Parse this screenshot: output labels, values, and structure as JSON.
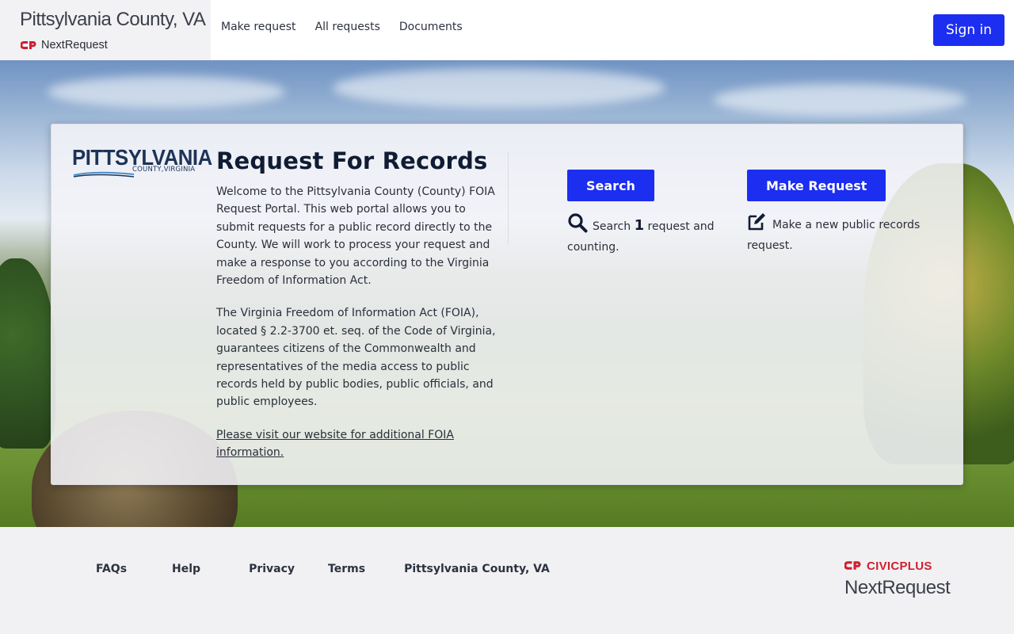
{
  "header": {
    "org_title": "Pittsylvania County, VA",
    "product_name": "NextRequest",
    "nav": [
      {
        "label": "Make request"
      },
      {
        "label": "All requests"
      },
      {
        "label": "Documents"
      }
    ],
    "signin_label": "Sign in"
  },
  "card": {
    "logo_word": "PITTSYLVANIA",
    "logo_tag": "COUNTY,VIRGINIA",
    "title": "Request For Records",
    "paragraph_1": "Welcome to the Pittsylvania County (County) FOIA Request Portal. This web portal allows you to submit requests for a public record directly to the County. We will work to process your request and make a response to you according to the Virginia Freedom of Information Act.",
    "paragraph_2": "The Virginia Freedom of Information Act (FOIA), located § 2.2-3700 et. seq. of the Code of Virginia, guarantees citizens of the Commonwealth and representatives of the media access to public records held by public bodies, public officials, and public employees.",
    "link_text": "Please visit our website for additional FOIA information.",
    "search": {
      "button_label": "Search",
      "desc_prefix": "Search",
      "count": "1",
      "desc_suffix": "request and counting.",
      "icon": "search-icon"
    },
    "make": {
      "button_label": "Make Request",
      "desc": "Make a new public records request.",
      "icon": "edit-icon"
    }
  },
  "footer": {
    "links": [
      {
        "label": "FAQs"
      },
      {
        "label": "Help"
      },
      {
        "label": "Privacy"
      },
      {
        "label": "Terms"
      },
      {
        "label": "Pittsylvania County, VA"
      }
    ],
    "civic_brand": "CIVICPLUS",
    "civic_product": "NextRequest"
  },
  "colors": {
    "accent": "#1c2ef0",
    "brand_red": "#d01f2e",
    "navy": "#1d3358"
  }
}
